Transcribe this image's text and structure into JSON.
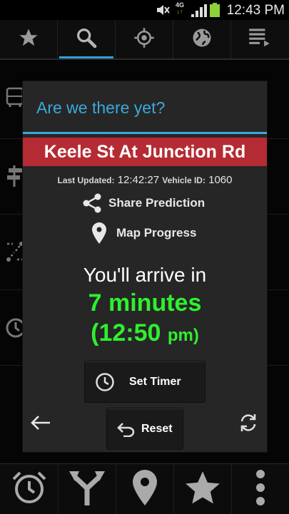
{
  "status_bar": {
    "time": "12:43 PM",
    "network": "4G",
    "icons": [
      "mute-icon",
      "network-4g-icon",
      "signal-icon",
      "battery-icon"
    ]
  },
  "top_tabs": [
    {
      "icon": "star-icon",
      "active": false
    },
    {
      "icon": "search-icon",
      "active": true
    },
    {
      "icon": "location-target-icon",
      "active": false
    },
    {
      "icon": "globe-icon",
      "active": false
    },
    {
      "icon": "list-icon",
      "active": false
    }
  ],
  "dialog": {
    "title": "Are we there yet?",
    "stop_name": "Keele St At Junction Rd",
    "last_updated_label": "Last Updated:",
    "last_updated_value": "12:42:27",
    "vehicle_id_label": "Vehicle ID:",
    "vehicle_id_value": "1060",
    "share_label": "Share Prediction",
    "map_label": "Map Progress",
    "arrive_text": "You'll arrive in",
    "minutes_text": "7 minutes",
    "arrival_time": "(12:50",
    "arrival_ampm": "pm)",
    "set_timer_label": "Set Timer",
    "reset_label": "Reset"
  },
  "bottom_tabs": [
    "alarm-clock-icon",
    "merge-route-icon",
    "map-pin-icon",
    "star-icon",
    "overflow-menu-icon"
  ],
  "colors": {
    "accent": "#3aa9dc",
    "banner": "#b52b33",
    "arrival": "#2ef02e",
    "tab_indicator": "#2f9fd6",
    "battery": "#8fd13a"
  }
}
